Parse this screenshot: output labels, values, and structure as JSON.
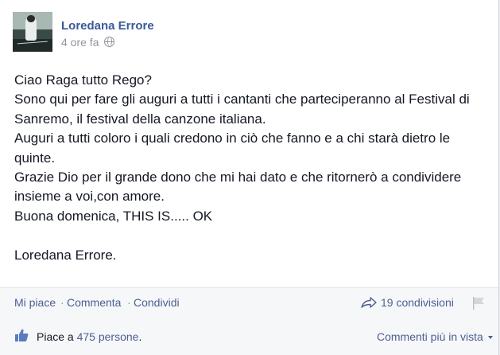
{
  "post": {
    "author": "Loredana Errore",
    "time": "4 ore fa",
    "privacy_icon": "globe-icon",
    "lines": [
      "Ciao Raga tutto Rego?",
      "Sono qui per fare gli auguri a tutti i cantanti che parteciperanno al Festival di",
      "Sanremo, il festival della canzone italiana.",
      "Auguri a tutti coloro i quali credono in ciò che fanno e a chi starà dietro le",
      "quinte.",
      "Grazie Dio per il grande dono che mi hai dato e che ritornerò a condividere",
      "insieme a voi,con amore.",
      "Buona domenica, THIS IS..... OK",
      "Loredana Errore."
    ]
  },
  "actions": {
    "like": "Mi piace",
    "separator": "·",
    "comment": "Commenta",
    "share": "Condividi",
    "shares": "19 condivisioni"
  },
  "likes": {
    "prefix": "Piace a ",
    "count": "475 persone",
    "suffix": ".",
    "sort": "Commenti più in vista"
  },
  "colors": {
    "link": "#4b5f91",
    "author": "#3b5998",
    "meta": "#90949c",
    "footer_bg": "#f6f7f9"
  }
}
